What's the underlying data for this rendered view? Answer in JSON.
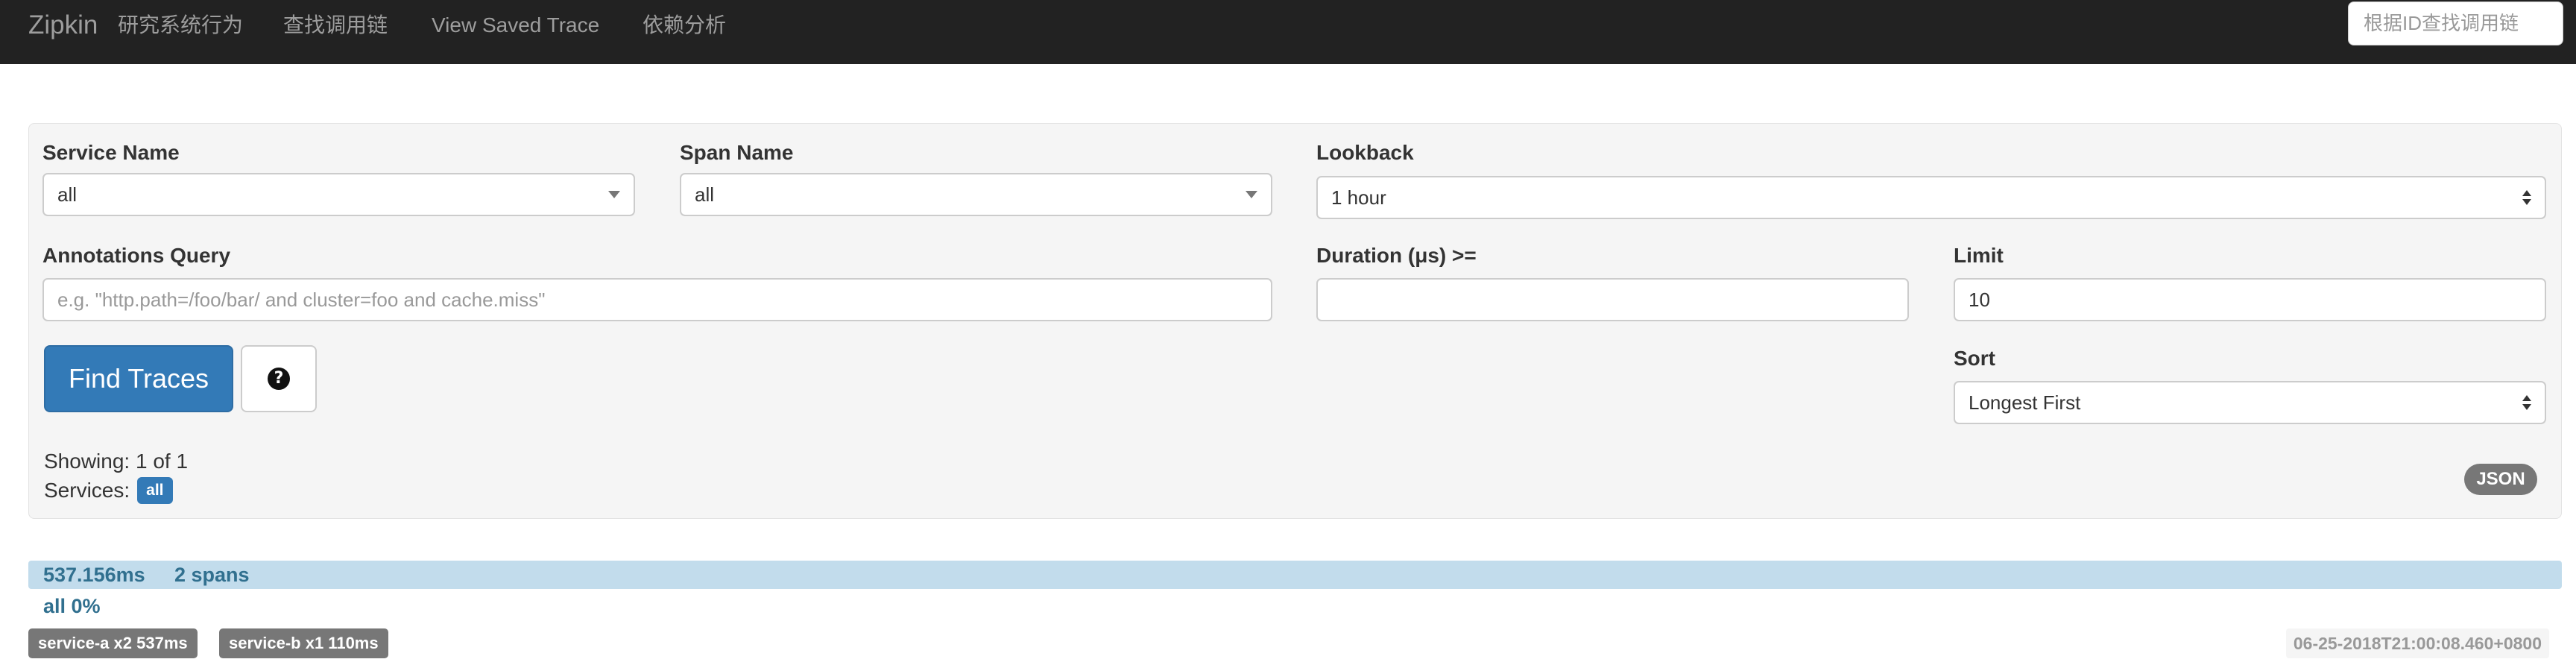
{
  "navbar": {
    "brand": "Zipkin",
    "links": [
      "研究系统行为",
      "查找调用链",
      "View Saved Trace",
      "依赖分析"
    ],
    "trace_id_placeholder": "根据ID查找调用链"
  },
  "search_form": {
    "service_name": {
      "label": "Service Name",
      "value": "all"
    },
    "span_name": {
      "label": "Span Name",
      "value": "all"
    },
    "lookback": {
      "label": "Lookback",
      "value": "1 hour"
    },
    "annotations_query": {
      "label": "Annotations Query",
      "placeholder": "e.g. \"http.path=/foo/bar/ and cluster=foo and cache.miss\""
    },
    "duration": {
      "label": "Duration (μs) >=",
      "value": ""
    },
    "limit": {
      "label": "Limit",
      "value": "10"
    },
    "sort": {
      "label": "Sort",
      "value": "Longest First"
    },
    "find_button": "Find Traces",
    "help_icon": "question-circle-icon",
    "help_glyph": "?"
  },
  "summary": {
    "showing": "Showing: 1 of 1",
    "services_label": "Services:",
    "services_badge": "all",
    "json_badge": "JSON"
  },
  "results": [
    {
      "duration": "537.156ms",
      "spans": "2 spans",
      "service_percent": "all 0%",
      "service_tags": [
        "service-a x2 537ms",
        "service-b x1 110ms"
      ],
      "timestamp": "06-25-2018T21:00:08.460+0800"
    }
  ],
  "colors": {
    "navbar_bg": "#222222",
    "primary": "#337ab7",
    "result_bar": "#c2dcec",
    "result_text": "#31708f",
    "tag_gray": "#777777"
  }
}
